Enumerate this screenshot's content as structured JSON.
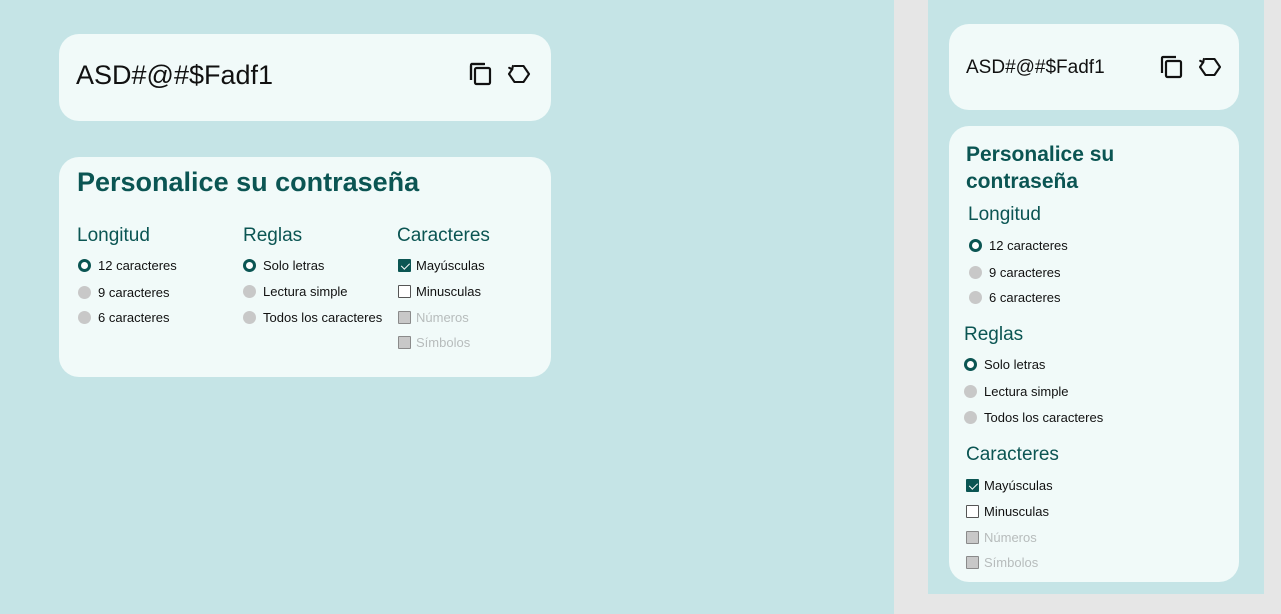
{
  "password": "ASD#@#$Fadf1",
  "generator": {
    "title": "Personalice su contraseña",
    "mobile_title_line1": "Personalice su",
    "mobile_title_line2": "contraseña",
    "length": {
      "label": "Longitud",
      "options": [
        "12 caracteres",
        "9 caracteres",
        "6 caracteres"
      ],
      "selected": "12 caracteres"
    },
    "rules": {
      "label": "Reglas",
      "options": [
        "Solo letras",
        "Lectura simple",
        "Todos los caracteres"
      ],
      "selected": "Solo letras"
    },
    "characters": {
      "label": "Caracteres",
      "options": [
        "Mayúsculas",
        "Minusculas",
        "Números",
        "Símbolos"
      ],
      "checked": [
        "Mayúsculas"
      ],
      "disabled": [
        "Números",
        "Símbolos"
      ]
    }
  },
  "icons": {
    "copy": "copy-icon",
    "regenerate": "regenerate-icon"
  },
  "colors": {
    "page_background": "#c5e4e6",
    "outer_background": "#e6e6e6",
    "card_background": "#f1faf9",
    "accent": "#0b5553",
    "disabled_text": "#b7bcbc"
  }
}
